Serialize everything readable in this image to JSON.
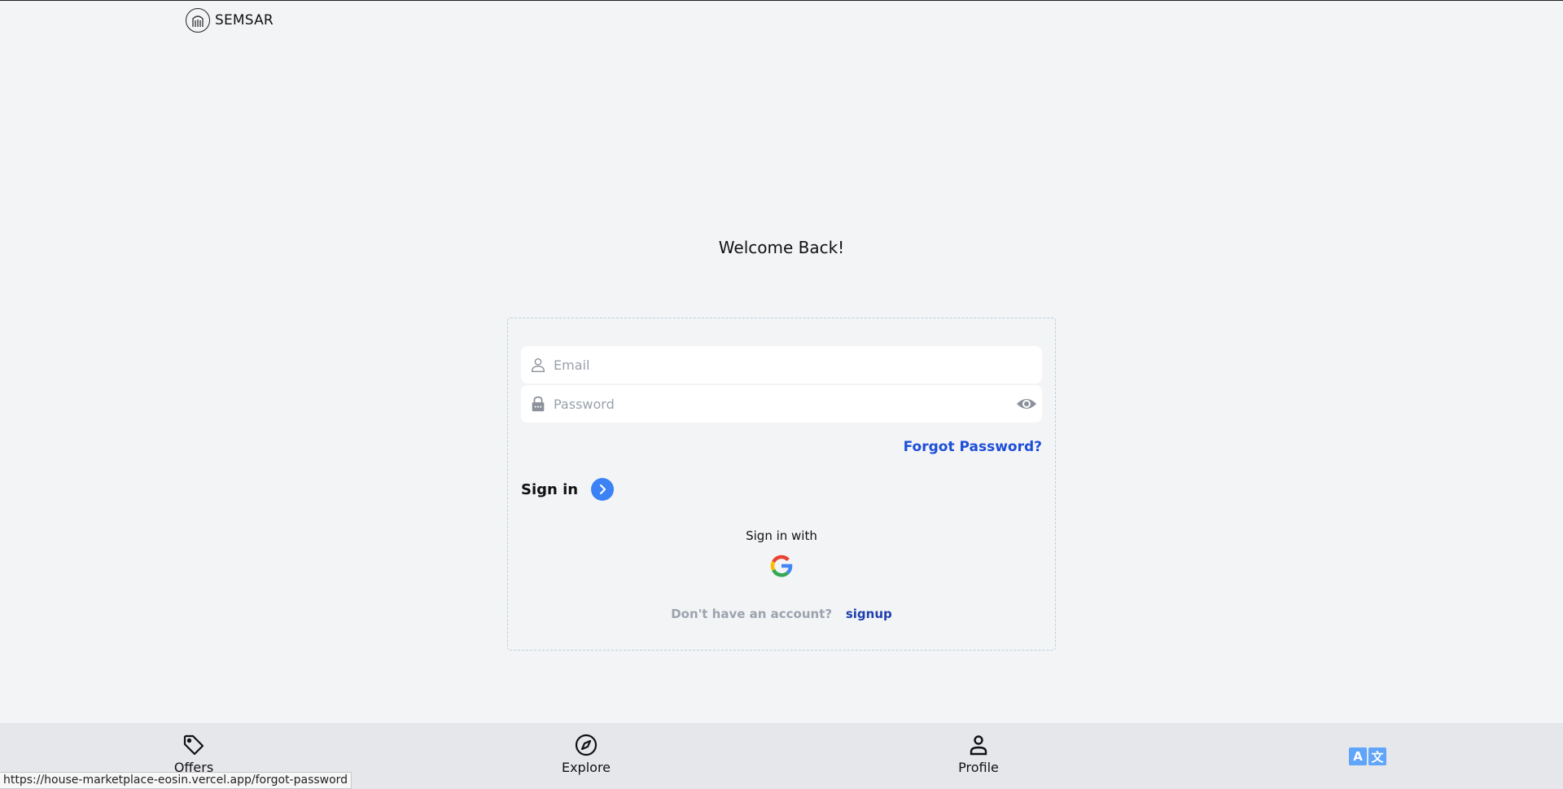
{
  "header": {
    "brand": "SEMSAR",
    "logo_icon": "gate-icon"
  },
  "page": {
    "title": "Welcome Back!"
  },
  "form": {
    "email_placeholder": "Email",
    "password_placeholder": "Password",
    "forgot_label": "Forgot Password?",
    "signin_label": "Sign in",
    "signin_with": "Sign in with",
    "no_account": "Don't have an account?",
    "signup_label": "signup"
  },
  "nav": {
    "items": [
      {
        "label": "Offers",
        "icon": "tag-icon"
      },
      {
        "label": "Explore",
        "icon": "compass-icon"
      },
      {
        "label": "Profile",
        "icon": "person-icon"
      }
    ],
    "lang_a": "A",
    "lang_b": "文",
    "lang_icon": "translate-icon"
  },
  "status_bar": {
    "url": "https://house-marketplace-eosin.vercel.app/forgot-password"
  },
  "colors": {
    "accent": "#3b82f6",
    "link": "#1d4ed8",
    "background": "#f3f4f6",
    "nav_bg": "#e5e7eb"
  }
}
